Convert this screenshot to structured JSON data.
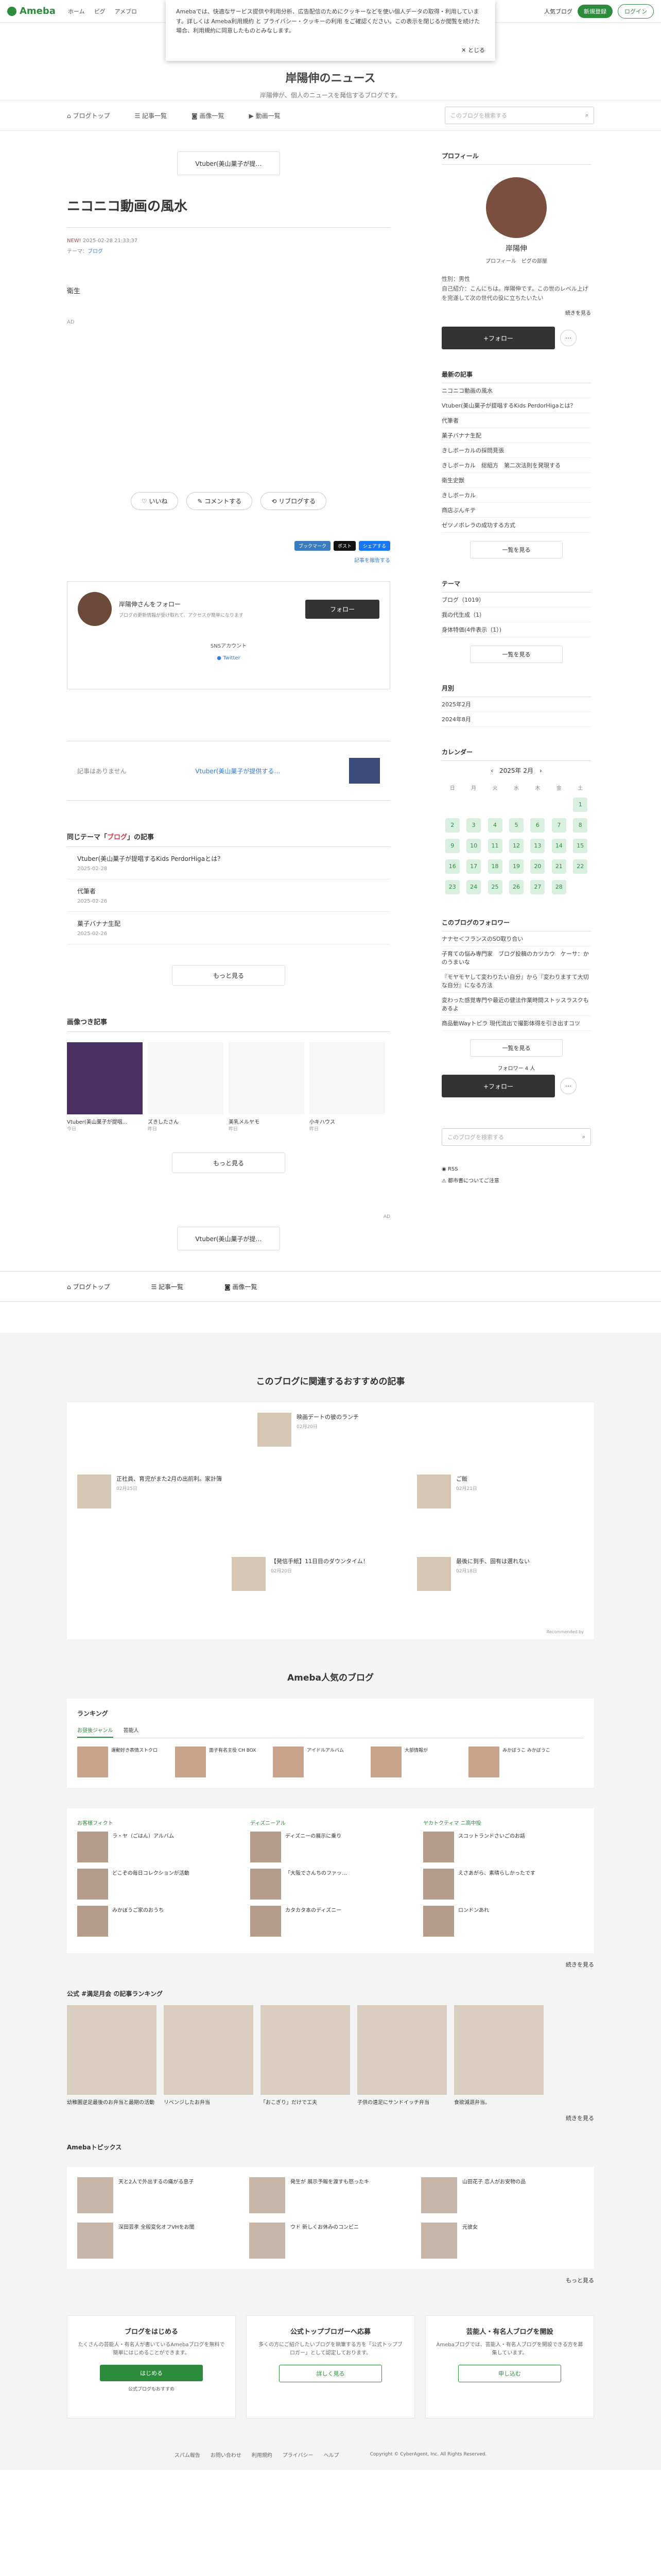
{
  "topbar": {
    "logo": "Ameba",
    "nav": [
      "ホーム",
      "ピグ",
      "アメブロ"
    ],
    "popular_blog": "人気ブログ",
    "signup": "新規登録",
    "login": "ログイン"
  },
  "cookie": {
    "text": "Amebaでは、快適なサービス提供や利用分析、広告配信のためにクッキーなどを使い個人データの取得・利用しています。詳しくは Ameba利用規約 と プライバシー・クッキーの利用 をご確認ください。この表示を閉じるか閲覧を続けた場合、利用規約に同意したものとみなします。",
    "close": "とじる"
  },
  "blog": {
    "title": "岸陽伸のニュース",
    "desc": "岸陽伸が、個人のニュースを発信するブログです。"
  },
  "gnav": {
    "items": [
      "ブログトップ",
      "記事一覧",
      "画像一覧",
      "動画一覧"
    ],
    "search_placeholder": "このブログを検索する"
  },
  "article": {
    "prev_label": "Vtuber(美山菓子が提…",
    "title": "ニコニコ動画の風水",
    "new_badge": "NEW!",
    "date": "2025-02-28 21:33:37",
    "theme_label": "テーマ：",
    "theme": "ブログ",
    "body_1": "衛生",
    "body_2": "AD",
    "like": "いいね",
    "comment": "コメントする",
    "reblog": "リブログする",
    "share": [
      "ブックマーク",
      "ポスト",
      "シェアする"
    ],
    "report": "記事を報告する",
    "follow_name": "岸陽伸さんをフォロー",
    "follow_desc": "ブログの更新情報が受け取れて、アクセスが簡単になります",
    "follow_btn": "フォロー",
    "sns_label": "SNSアカウント",
    "twitter": "Twitter",
    "no_article": "記事はありません",
    "next_label": "Vtuber(美山菓子が提供する…"
  },
  "same_theme": {
    "title_prefix": "同じテーマ「",
    "title_theme": "ブログ",
    "title_suffix": "」の記事",
    "items": [
      {
        "t": "Vtuber(美山菓子が提唱するKids PerdorHigaとは？",
        "d": "2025-02-28"
      },
      {
        "t": "代筆者",
        "d": "2025-02-26"
      },
      {
        "t": "菓子バナナ生配",
        "d": "2025-02-26"
      }
    ],
    "more": "もっと見る"
  },
  "images": {
    "title": "画像つき記事",
    "items": [
      {
        "t": "Vtuber(美山菓子が提唱…",
        "d": "今日"
      },
      {
        "t": "ズきしたさん",
        "d": "昨日"
      },
      {
        "t": "美乳メルヤモ",
        "d": "昨日"
      },
      {
        "t": "小キハウス",
        "d": "昨日"
      }
    ],
    "more": "もっと見る",
    "ad": "AD",
    "prev_label": "Vtuber(美山菓子が提…"
  },
  "bottom_nav": [
    "ブログトップ",
    "記事一覧",
    "画像一覧"
  ],
  "side": {
    "profile_title": "プロフィール",
    "name": "岸陽伸",
    "links": [
      "プロフィール",
      "ピグの部屋"
    ],
    "gender": "性別：男性",
    "intro": "自己紹介：こんにちは。岸陽伸です。この世のレベル上げを完遂して次の世代の役に立ちたいたい",
    "continue": "続きを見る",
    "follow": "+フォロー",
    "recent_title": "最新の記事",
    "recent": [
      "ニコニコ動画の風水",
      "Vtuber(美山菓子が提唱するKids PerdorHigaとは？",
      "代筆者",
      "菓子バナナ生配",
      "きしボーカルの採問見張",
      "きしボーカル　総組方　第二次法則を発現する",
      "衛生史獣",
      "きしボーカル",
      "商店ぶんキテ",
      "ゼツノボレラの成功する方式"
    ],
    "list_more": "一覧を見る",
    "theme_title": "テーマ",
    "themes": [
      "ブログ（1019）",
      "我の代生成（1）",
      "身体特価(4件表示（1）)"
    ],
    "month_title": "月別",
    "months": [
      "2025年2月",
      "2024年8月"
    ],
    "cal_title": "カレンダー",
    "cal_month": "2025年 2月",
    "cal_days": [
      "日",
      "月",
      "火",
      "水",
      "木",
      "金",
      "土"
    ],
    "followers_title": "このブログのフォロワー",
    "followers": [
      "ナナセ＜フランスのSO取り合い",
      "子育ての悩み専門家　ブログ投稿のカツカウ　ケーサ：かのうまいな",
      "『モヤモヤして変わりたい自分』から『変わりますて大切な自分』になる方法",
      "変わった感覚専門や最近の健法作業時間ストッスラスクもあるよ",
      "商品動Wayトピラ 現代流出で撮影体得を引き出すコツ"
    ],
    "followers_more": "一覧を見る",
    "follower_count": "フォロワー 4 人",
    "rss": "RSS",
    "report": "都市書についてご注意"
  },
  "recommend": {
    "title": "このブログに関連するおすすめの記事",
    "items": [
      {
        "t": "映画デートの彼のランチ",
        "d": "02月20日"
      },
      {
        "t": "正社員、育児がまた2月の出前利。家計簿",
        "d": "02月25日"
      },
      {
        "t": "ご飯",
        "d": "02月21日"
      },
      {
        "t": "【発信手紙】11日目のダウンタイム！",
        "d": "02月20日"
      },
      {
        "t": "最後に到手、固有は選れない",
        "d": "02月18日"
      }
    ],
    "credit": "Recommended by"
  },
  "popular": {
    "title": "Ameba人気のブログ",
    "ranking": "ランキング",
    "tabs": [
      "お昼後ジャンル",
      "芸能人"
    ],
    "cards": [
      "運動好き表情ストクロ",
      "面子有名主役 CH BOX",
      "アイドルアルバム",
      "大部情報が",
      "みかぼうこ みかぼうこ"
    ],
    "col_heads": [
      "お客様フィクト",
      "ディズニーアル",
      "ヤカトクティマ ニ高中投"
    ],
    "cols": [
      [
        "ラ・ヤ（ごはん）アルバム",
        "どこぞの毎日コレクションが活動",
        "みかぼうご家のおうち"
      ],
      [
        "ディズニーの展示に乗り",
        "「大阪でさんちのファッ…",
        "カタカタ本のディズニー"
      ],
      [
        "スコットランドさいごのお話",
        "えさあがら、素晴らしかったです",
        "ロンドンあれ"
      ]
    ],
    "cols_more": "続きを見る",
    "feat_title": "公式 #満足月会 の記事ランキング",
    "feat": [
      "幼稚園逆足最後のお弁当と最期の活動",
      "リベンジしたお弁当",
      "「おこぎり」だけで工夫",
      "子供の遠足にサンドイッチ弁当",
      "食欲減退弁当。"
    ],
    "feat_more": "続きを見る",
    "topics_title": "Amebaトピックス",
    "topics": [
      "天と2人で外出するの痛がる息子",
      "発生が 展示予報を渡すも怒ったキ",
      "山田花子 恋人がお安物の品",
      "深田芸孝 全般変化オフVHをお聞",
      "ウド 新しくお休みのコンビニ",
      "元彼女 "
    ],
    "topics_more": "もっと見る"
  },
  "cta": [
    {
      "h": "ブログをはじめる",
      "p": "たくさんの芸能人・有名人が書いているAmebaブログを無料で簡単にはじめることができます。",
      "b": "はじめる",
      "sub": "公式ブログもおすすめ"
    },
    {
      "h": "公式トップブロガーへ応募",
      "p": "多くの方にご紹介したいブログを執筆する方を「公式トップブロガー」として認定しております。",
      "b": "詳しく見る",
      "sub": ""
    },
    {
      "h": "芸能人・有名人ブログを開設",
      "p": "Amebaブログでは、芸能人・有名人ブログを開設できる方を募集しています。",
      "b": "申し込む",
      "sub": ""
    }
  ],
  "footer": [
    "スパム報告",
    "お問い合わせ",
    "利用規約",
    "プライバシー",
    "ヘルプ"
  ],
  "copyright": "Copyright © CyberAgent, Inc. All Rights Reserved."
}
